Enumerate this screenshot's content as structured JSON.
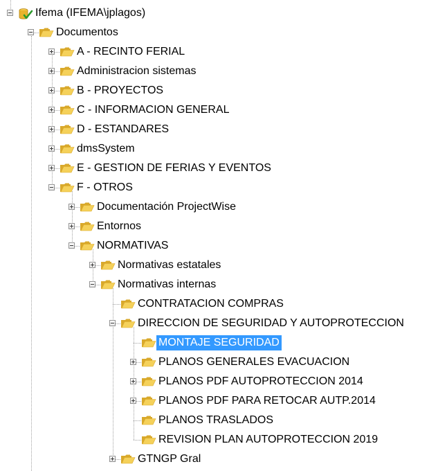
{
  "tree": {
    "nodes": [
      {
        "label": "Ifema (IFEMA\\jplagos)",
        "icon": "datasource-icon",
        "toggle": "expanded"
      },
      {
        "label": "Documentos",
        "icon": "folder-open-icon",
        "toggle": "expanded"
      },
      {
        "label": "A - RECINTO FERIAL",
        "icon": "folder-icon",
        "toggle": "collapsed"
      },
      {
        "label": "Administracion sistemas",
        "icon": "folder-icon",
        "toggle": "collapsed"
      },
      {
        "label": "B - PROYECTOS",
        "icon": "folder-icon",
        "toggle": "collapsed"
      },
      {
        "label": "C - INFORMACION GENERAL",
        "icon": "folder-icon",
        "toggle": "collapsed"
      },
      {
        "label": "D - ESTANDARES",
        "icon": "folder-icon",
        "toggle": "collapsed"
      },
      {
        "label": "dmsSystem",
        "icon": "folder-icon",
        "toggle": "collapsed"
      },
      {
        "label": "E - GESTION DE FERIAS Y EVENTOS",
        "icon": "folder-icon",
        "toggle": "collapsed"
      },
      {
        "label": "F - OTROS",
        "icon": "folder-open-icon",
        "toggle": "expanded"
      },
      {
        "label": "Documentación ProjectWise",
        "icon": "folder-icon",
        "toggle": "collapsed"
      },
      {
        "label": "Entornos",
        "icon": "folder-icon",
        "toggle": "collapsed"
      },
      {
        "label": "NORMATIVAS",
        "icon": "folder-open-icon",
        "toggle": "expanded"
      },
      {
        "label": "Normativas estatales",
        "icon": "folder-icon",
        "toggle": "collapsed"
      },
      {
        "label": "Normativas internas",
        "icon": "folder-open-icon",
        "toggle": "expanded"
      },
      {
        "label": "CONTRATACION COMPRAS",
        "icon": "folder-icon",
        "toggle": "none"
      },
      {
        "label": "DIRECCION DE SEGURIDAD Y AUTOPROTECCION",
        "icon": "folder-open-icon",
        "toggle": "expanded"
      },
      {
        "label": "MONTAJE SEGURIDAD",
        "icon": "folder-icon",
        "toggle": "none",
        "selected": true
      },
      {
        "label": "PLANOS GENERALES EVACUACION",
        "icon": "folder-icon",
        "toggle": "collapsed"
      },
      {
        "label": "PLANOS PDF AUTOPROTECCION 2014",
        "icon": "folder-icon",
        "toggle": "collapsed"
      },
      {
        "label": "PLANOS PDF PARA RETOCAR AUTP.2014",
        "icon": "folder-icon",
        "toggle": "collapsed"
      },
      {
        "label": "PLANOS TRASLADOS",
        "icon": "folder-icon",
        "toggle": "none"
      },
      {
        "label": "REVISION PLAN AUTOPROTECCION 2019",
        "icon": "folder-icon",
        "toggle": "none"
      },
      {
        "label": "GTNGP Gral",
        "icon": "folder-icon",
        "toggle": "collapsed"
      }
    ]
  },
  "colors": {
    "selection": "#3399ff",
    "folder": "#f5d15a",
    "folder_dark": "#d9a92b",
    "connector": "#a0a0a0"
  }
}
